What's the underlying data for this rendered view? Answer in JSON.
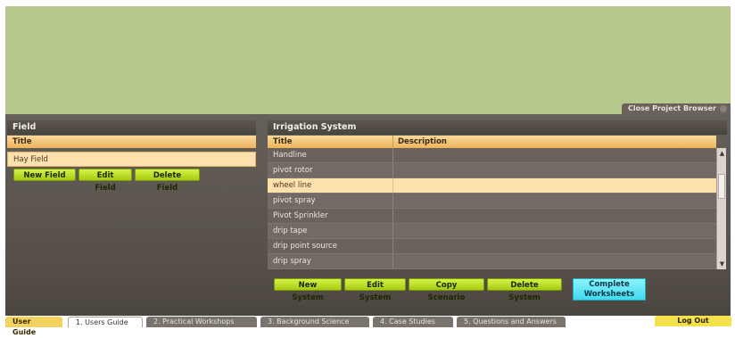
{
  "browser": {
    "close_label": "Close Project Browser"
  },
  "field_panel": {
    "title": "Field",
    "column_title": "Title",
    "rows": [
      "Hay Field"
    ],
    "buttons": {
      "new": "New Field",
      "edit": "Edit Field",
      "delete": "Delete Field"
    }
  },
  "irrigation_panel": {
    "title": "Irrigation System",
    "columns": {
      "title": "Title",
      "description": "Description"
    },
    "rows": [
      {
        "title": "Handline",
        "description": ""
      },
      {
        "title": "pivot rotor",
        "description": ""
      },
      {
        "title": "wheel line",
        "description": ""
      },
      {
        "title": "pivot spray",
        "description": ""
      },
      {
        "title": "Pivot Sprinkler",
        "description": ""
      },
      {
        "title": "drip tape",
        "description": ""
      },
      {
        "title": "drip point source",
        "description": ""
      },
      {
        "title": "drip spray",
        "description": ""
      }
    ],
    "selected_index": 2,
    "buttons": {
      "new": "New System",
      "edit": "Edit System",
      "copy": "Copy Scenario",
      "delete": "Delete System",
      "complete_line1": "Complete",
      "complete_line2": "Worksheets"
    }
  },
  "tabs": {
    "user_guide": "User Guide",
    "items": [
      "1. Users Guide",
      "2. Practical Workshops",
      "3. Background Science",
      "4. Case Studies",
      "5. Questions and Answers"
    ],
    "logout": "Log Out"
  },
  "colors": {
    "accent_green": "#bfe02a",
    "selection": "#fde1ac",
    "complete": "#5ce5f5"
  }
}
